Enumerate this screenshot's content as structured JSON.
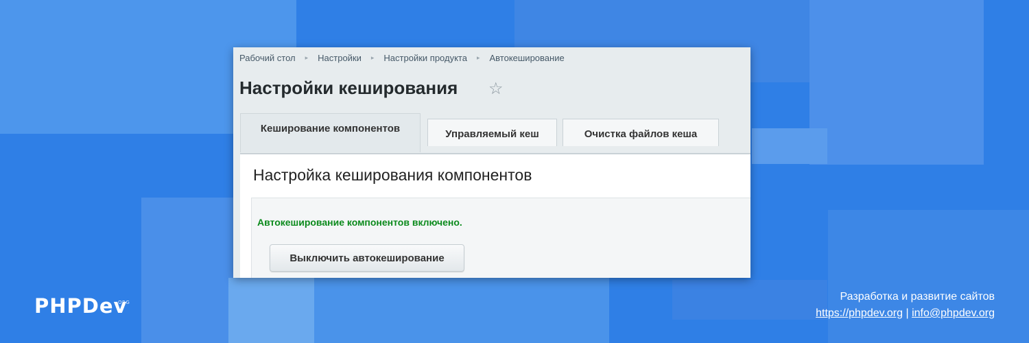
{
  "breadcrumb": {
    "items": [
      "Рабочий стол",
      "Настройки",
      "Настройки продукта",
      "Автокеширование"
    ],
    "separator": "▸"
  },
  "page": {
    "title": "Настройки кеширования",
    "favorite_icon": "star-outline-icon"
  },
  "tabs": [
    {
      "label": "Кеширование компонентов",
      "active": true
    },
    {
      "label": "Управляемый кеш",
      "active": false
    },
    {
      "label": "Очистка файлов кеша",
      "active": false
    }
  ],
  "section": {
    "title": "Настройка кеширования компонентов",
    "status": "Автокеширование компонентов включено.",
    "button_label": "Выключить автокеширование"
  },
  "branding": {
    "logo_text": "PHPDev",
    "logo_suffix": "ORG"
  },
  "footer": {
    "tagline": "Разработка и развитие сайтов",
    "site_link": "https://phpdev.org",
    "divider": "|",
    "email_link": "info@phpdev.org"
  },
  "colors": {
    "background": "#2f7fe6",
    "status_green": "#0b8a1c",
    "title_text": "#242a2d"
  }
}
